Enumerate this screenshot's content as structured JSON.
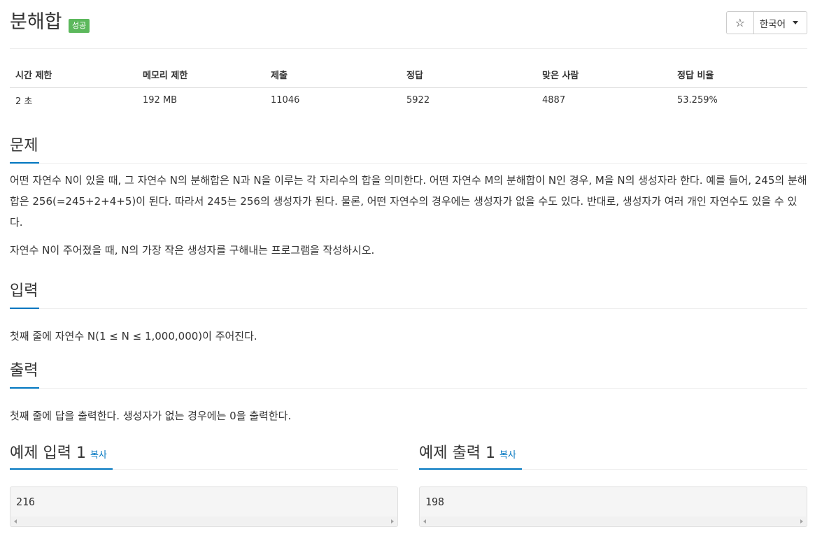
{
  "problem": {
    "title": "분해합",
    "status_badge": "성공"
  },
  "header": {
    "star_icon": "☆",
    "language_label": "한국어"
  },
  "info_table": {
    "headers": [
      "시간 제한",
      "메모리 제한",
      "제출",
      "정답",
      "맞은 사람",
      "정답 비율"
    ],
    "values": [
      "2 초",
      "192 MB",
      "11046",
      "5922",
      "4887",
      "53.259%"
    ]
  },
  "sections": {
    "description": {
      "heading": "문제",
      "paragraphs": [
        "어떤 자연수 N이 있을 때, 그 자연수 N의 분해합은 N과 N을 이루는 각 자리수의 합을 의미한다. 어떤 자연수 M의 분해합이 N인 경우, M을 N의 생성자라 한다. 예를 들어, 245의 분해합은 256(=245+2+4+5)이 된다. 따라서 245는 256의 생성자가 된다. 물론, 어떤 자연수의 경우에는 생성자가 없을 수도 있다. 반대로, 생성자가 여러 개인 자연수도 있을 수 있다.",
        "자연수 N이 주어졌을 때, N의 가장 작은 생성자를 구해내는 프로그램을 작성하시오."
      ]
    },
    "input": {
      "heading": "입력",
      "text": "첫째 줄에 자연수 N(1 ≤ N ≤ 1,000,000)이 주어진다."
    },
    "output": {
      "heading": "출력",
      "text": "첫째 줄에 답을 출력한다. 생성자가 없는 경우에는 0을 출력한다."
    }
  },
  "examples": {
    "input": {
      "heading": "예제 입력 1",
      "copy_label": "복사",
      "value": "216"
    },
    "output": {
      "heading": "예제 출력 1",
      "copy_label": "복사",
      "value": "198"
    }
  },
  "colors": {
    "accent": "#0076c0",
    "success_badge": "#5cb85c"
  }
}
